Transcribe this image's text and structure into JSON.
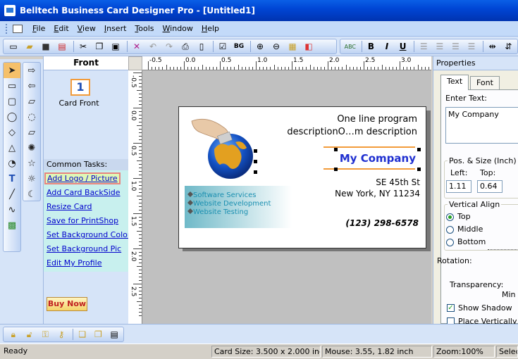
{
  "titlebar": {
    "title": "Belltech Business Card Designer Pro  - [Untitled1]"
  },
  "menu": [
    "File",
    "Edit",
    "View",
    "Insert",
    "Tools",
    "Window",
    "Help"
  ],
  "front_panel": {
    "header": "Front",
    "card_number": "1",
    "card_label": "Card Front",
    "tasks_header": "Common Tasks:",
    "tasks": [
      "Add Logo / Picture",
      "Add Card BackSide",
      "Resize Card",
      "Save for PrintShop",
      "Set Background Color",
      "Set Background Pic",
      "Edit My Profile"
    ],
    "buy_now": "Buy Now"
  },
  "ruler": {
    "h_labels": [
      "-0.5",
      "0.0",
      "0.5",
      "1.0",
      "1.5",
      "2.0",
      "2.5",
      "3.0",
      "3.5"
    ],
    "v_labels": [
      "-0.5",
      "0.0",
      "0.5",
      "1.0",
      "1.5",
      "2.0",
      "2.5"
    ]
  },
  "card": {
    "program_line1": "One line program",
    "program_line2": "descriptionO…m description",
    "company": "My Company",
    "address_line1": "SE 45th St",
    "address_line2": "New York, NY 11234",
    "phone": "(123) 298-6578",
    "services": [
      "Software Services",
      "Website Development",
      "Website Testing"
    ]
  },
  "properties": {
    "header": "Properties",
    "tabs": [
      "Text",
      "Font"
    ],
    "enter_text_label": "Enter Text:",
    "enter_text_value": "My Company",
    "pos_size_label": "Pos. & Size (Inch)",
    "left_label": "Left:",
    "top_label": "Top:",
    "left_value": "1.11",
    "top_value": "0.64",
    "v_align_label": "Vertical Align",
    "v_align_options": [
      "Top",
      "Middle",
      "Bottom"
    ],
    "rotation_label": "Rotation:",
    "transparency_label": "Transparency:",
    "min_label": "Min",
    "show_shadow": "Show Shadow",
    "place_vertically": "Place Vertically"
  },
  "status": {
    "ready": "Ready",
    "card_size": "Card Size: 3.500 x 2.000 inch",
    "mouse": "Mouse: 3.55, 1.82 inch",
    "zoom": "Zoom:100%",
    "select": "Select"
  },
  "colors": {
    "titlebar": "#0046d5",
    "accent_orange": "#f29b3a",
    "company_blue": "#1f2fd0",
    "services_teal": "#1a8fb0"
  }
}
